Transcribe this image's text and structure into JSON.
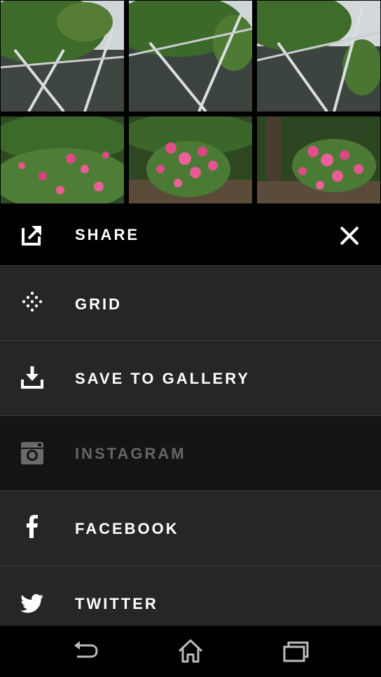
{
  "photos": [
    {
      "name": "photo-1",
      "kind": "tree"
    },
    {
      "name": "photo-2",
      "kind": "tree"
    },
    {
      "name": "photo-3",
      "kind": "tree"
    },
    {
      "name": "photo-4",
      "kind": "flowers"
    },
    {
      "name": "photo-5",
      "kind": "flowers"
    },
    {
      "name": "photo-6",
      "kind": "flowers"
    }
  ],
  "share": {
    "title": "SHARE",
    "icon": "share-icon",
    "close_icon": "close-icon"
  },
  "options": [
    {
      "label": "GRID",
      "icon": "grid-icon",
      "enabled": true
    },
    {
      "label": "SAVE TO GALLERY",
      "icon": "download-icon",
      "enabled": true
    },
    {
      "label": "INSTAGRAM",
      "icon": "instagram-icon",
      "enabled": false
    },
    {
      "label": "FACEBOOK",
      "icon": "facebook-icon",
      "enabled": true
    },
    {
      "label": "TWITTER",
      "icon": "twitter-icon",
      "enabled": true
    }
  ],
  "navbar": {
    "back_icon": "back-icon",
    "home_icon": "home-icon",
    "recents_icon": "recents-icon"
  },
  "colors": {
    "sheet_bg": "#262626",
    "disabled_bg": "#141414",
    "text": "#ffffff",
    "disabled_text": "#666666"
  }
}
